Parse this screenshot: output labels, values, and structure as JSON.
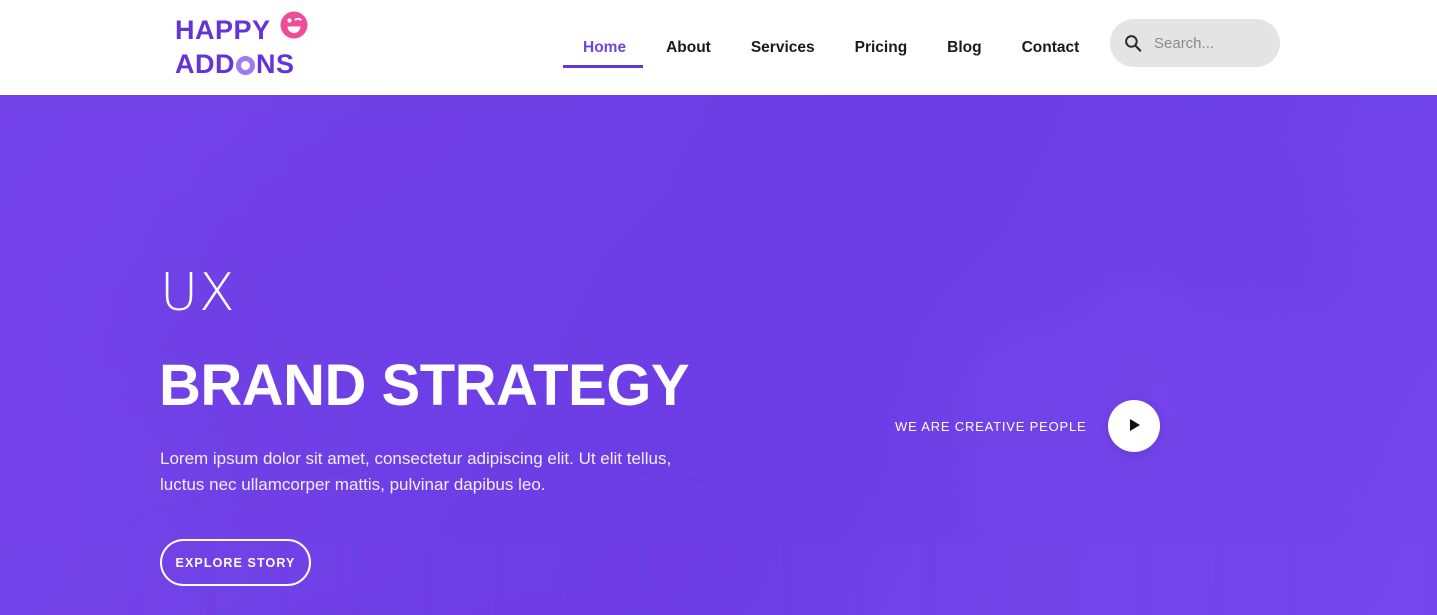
{
  "header": {
    "logo": {
      "line1": "HAPPY",
      "line2_pre": "ADD",
      "line2_post": "NS",
      "face_icon": "winking-face-icon",
      "purple": "#6434D8",
      "pink": "#EE4D97",
      "light_purple": "#9E7CF0"
    },
    "nav": {
      "items": [
        {
          "label": "Home",
          "active": true
        },
        {
          "label": "About",
          "active": false
        },
        {
          "label": "Services",
          "active": false
        },
        {
          "label": "Pricing",
          "active": false
        },
        {
          "label": "Blog",
          "active": false
        },
        {
          "label": "Contact",
          "active": false
        }
      ],
      "active_color": "#6C47E0",
      "inactive_color": "#1a1a1a"
    },
    "search": {
      "icon": "search-icon",
      "placeholder": "Search...",
      "value": "",
      "background": "#e4e4e4"
    }
  },
  "hero": {
    "background_color": "#7044E8",
    "eyebrow": "UX",
    "headline": "BRAND STRATEGY",
    "subtext": "Lorem ipsum dolor sit amet, consectetur adipiscing elit. Ut elit tellus, luctus nec ullamcorper mattis, pulvinar dapibus leo.",
    "cta_label": "EXPLORE STORY",
    "video": {
      "label": "WE ARE CREATIVE PEOPLE",
      "play_icon": "play-icon"
    }
  }
}
